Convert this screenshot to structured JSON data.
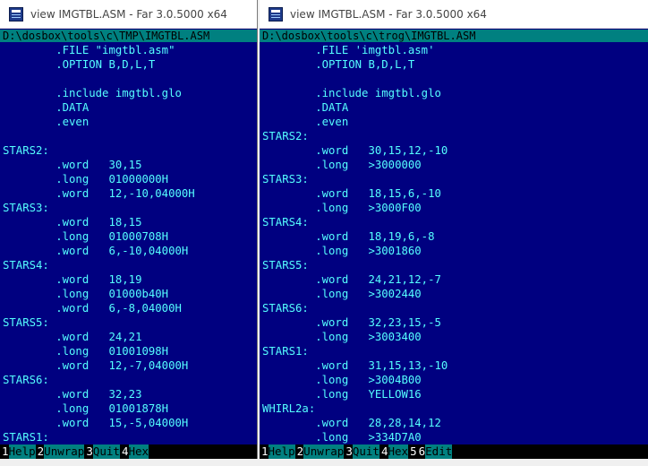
{
  "colors": {
    "panel_bg": "#000080",
    "code_text": "#55ffff",
    "bar_bg": "#008080"
  },
  "left_window": {
    "title": "view IMGTBL.ASM - Far 3.0.5000 x64",
    "path": "D:\\dosbox\\tools\\c\\TMP\\IMGTBL.ASM",
    "lines": [
      "        .FILE \"imgtbl.asm\"",
      "        .OPTION B,D,L,T",
      "",
      "        .include imgtbl.glo",
      "        .DATA",
      "        .even",
      "",
      "STARS2:",
      "        .word   30,15",
      "        .long   01000000H",
      "        .word   12,-10,04000H",
      "STARS3:",
      "        .word   18,15",
      "        .long   01000708H",
      "        .word   6,-10,04000H",
      "STARS4:",
      "        .word   18,19",
      "        .long   01000b40H",
      "        .word   6,-8,04000H",
      "STARS5:",
      "        .word   24,21",
      "        .long   01001098H",
      "        .word   12,-7,04000H",
      "STARS6:",
      "        .word   32,23",
      "        .long   01001878H",
      "        .word   15,-5,04000H",
      "STARS1:"
    ],
    "keys": [
      {
        "num": "1",
        "label": "Help  "
      },
      {
        "num": "2",
        "label": "Unwrap"
      },
      {
        "num": "3",
        "label": "Quit  "
      },
      {
        "num": "4",
        "label": "Hex   "
      }
    ]
  },
  "right_window": {
    "title": "view IMGTBL.ASM - Far 3.0.5000 x64",
    "path": "D:\\dosbox\\tools\\c\\trog\\IMGTBL.ASM",
    "lines": [
      "        .FILE 'imgtbl.asm'",
      "        .OPTION B,D,L,T",
      "",
      "        .include imgtbl.glo",
      "        .DATA",
      "        .even",
      "STARS2:",
      "        .word   30,15,12,-10",
      "        .long   >3000000",
      "STARS3:",
      "        .word   18,15,6,-10",
      "        .long   >3000F00",
      "STARS4:",
      "        .word   18,19,6,-8",
      "        .long   >3001860",
      "STARS5:",
      "        .word   24,21,12,-7",
      "        .long   >3002440",
      "STARS6:",
      "        .word   32,23,15,-5",
      "        .long   >3003400",
      "STARS1:",
      "        .word   31,15,13,-10",
      "        .long   >3004B00",
      "        .long   YELLOW16",
      "WHIRL2a:",
      "        .word   28,28,14,12",
      "        .long   >334D7A0"
    ],
    "keys": [
      {
        "num": "1",
        "label": "Help  "
      },
      {
        "num": "2",
        "label": "Unwrap"
      },
      {
        "num": "3",
        "label": "Quit  "
      },
      {
        "num": "4",
        "label": "Hex   "
      },
      {
        "num": "5",
        "label": "      "
      },
      {
        "num": "6",
        "label": "Edit  "
      }
    ]
  }
}
